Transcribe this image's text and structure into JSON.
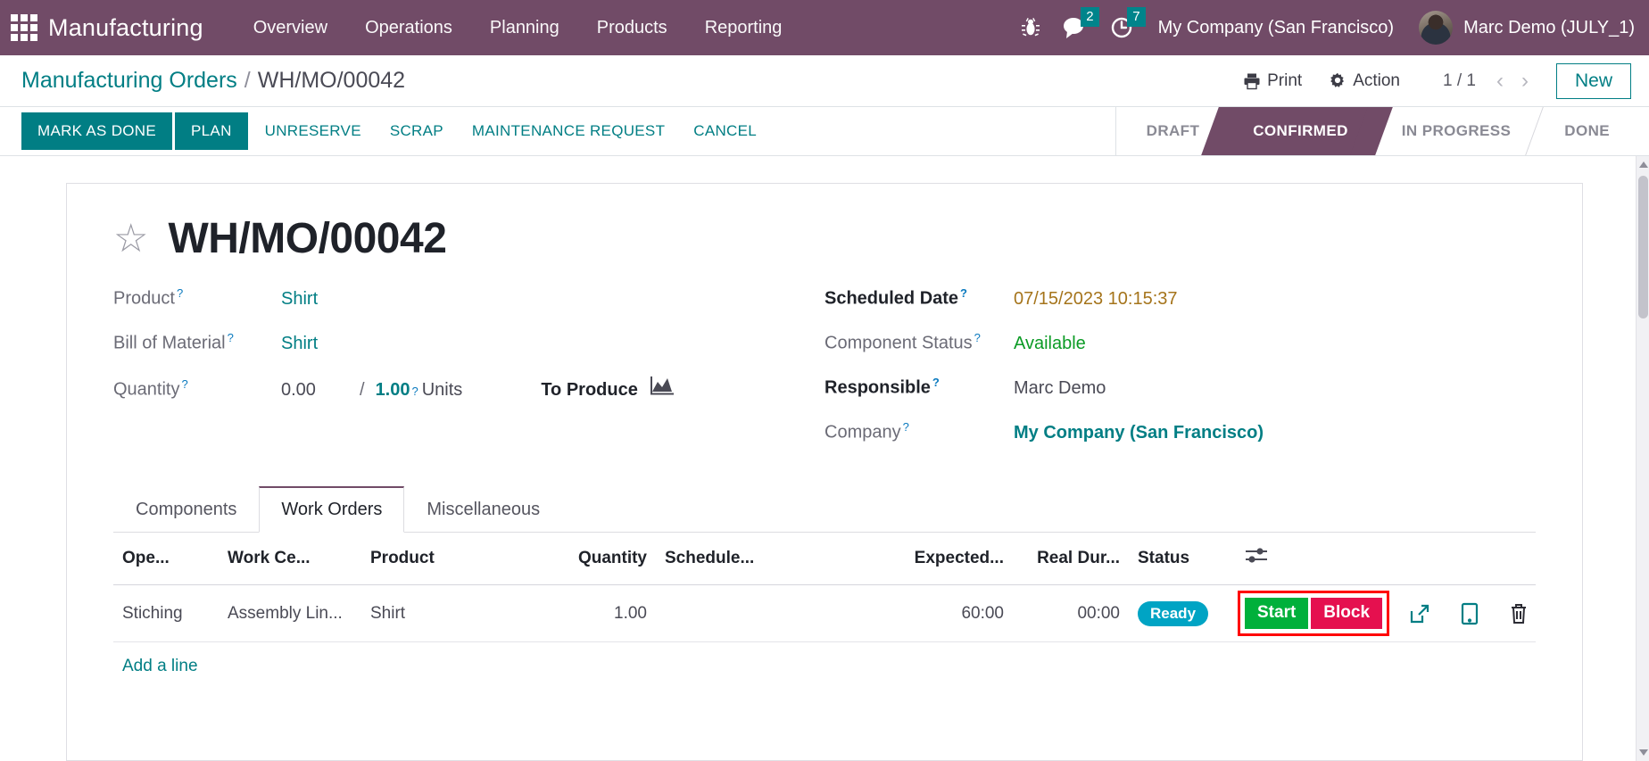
{
  "navbar": {
    "apps_icon": "apps-grid-icon",
    "brand": "Manufacturing",
    "menu": [
      {
        "label": "Overview"
      },
      {
        "label": "Operations"
      },
      {
        "label": "Planning"
      },
      {
        "label": "Products"
      },
      {
        "label": "Reporting"
      }
    ],
    "bug_icon": "bug-icon",
    "messages": {
      "icon": "chat-bubble-icon",
      "count": "2"
    },
    "activities": {
      "icon": "clock-icon",
      "count": "7"
    },
    "company": "My Company (San Francisco)",
    "user": "Marc Demo (JULY_1)"
  },
  "control_panel": {
    "breadcrumb_root": "Manufacturing Orders",
    "breadcrumb_sep": "/",
    "breadcrumb_current": "WH/MO/00042",
    "print_label": "Print",
    "action_label": "Action",
    "pager": "1 / 1",
    "prev_icon": "chevron-left-icon",
    "next_icon": "chevron-right-icon",
    "new_label": "New"
  },
  "action_bar": {
    "buttons": [
      {
        "label": "MARK AS DONE",
        "style": "primary"
      },
      {
        "label": "PLAN",
        "style": "primary"
      },
      {
        "label": "UNRESERVE",
        "style": "link"
      },
      {
        "label": "SCRAP",
        "style": "link"
      },
      {
        "label": "MAINTENANCE REQUEST",
        "style": "link"
      },
      {
        "label": "CANCEL",
        "style": "link"
      }
    ],
    "stages": [
      {
        "label": "DRAFT",
        "active": false
      },
      {
        "label": "CONFIRMED",
        "active": true
      },
      {
        "label": "IN PROGRESS",
        "active": false
      },
      {
        "label": "DONE",
        "active": false
      }
    ]
  },
  "form": {
    "star_icon": "star-outline-icon",
    "title": "WH/MO/00042",
    "left": {
      "product_label": "Product",
      "product_value": "Shirt",
      "bom_label": "Bill of Material",
      "bom_value": "Shirt",
      "quantity_label": "Quantity",
      "quantity_done": "0.00",
      "quantity_slash": "/",
      "quantity_target": "1.00",
      "quantity_uom": "Units",
      "to_produce_label": "To Produce",
      "to_produce_icon": "area-chart-icon"
    },
    "right": {
      "scheduled_label": "Scheduled Date",
      "scheduled_value": "07/15/2023 10:15:37",
      "component_status_label": "Component Status",
      "component_status_value": "Available",
      "responsible_label": "Responsible",
      "responsible_value": "Marc Demo",
      "company_label": "Company",
      "company_value": "My Company (San Francisco)"
    },
    "tooltip_marker": "?"
  },
  "notebook": {
    "tabs": [
      {
        "label": "Components",
        "active": false
      },
      {
        "label": "Work Orders",
        "active": true
      },
      {
        "label": "Miscellaneous",
        "active": false
      }
    ]
  },
  "work_orders": {
    "columns": [
      "Ope...",
      "Work Ce...",
      "Product",
      "Quantity",
      "Schedule...",
      "Expected...",
      "Real Dur...",
      "Status"
    ],
    "optional_columns_icon": "column-settings-icon",
    "rows": [
      {
        "operation": "Stiching",
        "work_center": "Assembly Lin...",
        "product": "Shirt",
        "quantity": "1.00",
        "scheduled": "",
        "expected_duration": "60:00",
        "real_duration": "00:00",
        "status": "Ready",
        "start_label": "Start",
        "block_label": "Block",
        "open_icon": "external-link-icon",
        "tablet_icon": "tablet-icon",
        "delete_icon": "trash-icon"
      }
    ],
    "add_line_label": "Add a line"
  },
  "colors": {
    "brand_purple": "#714b67",
    "accent_teal": "#017e84",
    "badge_teal": "#00848b",
    "status_ready": "#00a4c4",
    "start_green": "#00b03b",
    "block_red": "#e5104f",
    "highlight_box": "#ff0000",
    "value_orange": "#a5741b",
    "value_green": "#0b9b25"
  }
}
